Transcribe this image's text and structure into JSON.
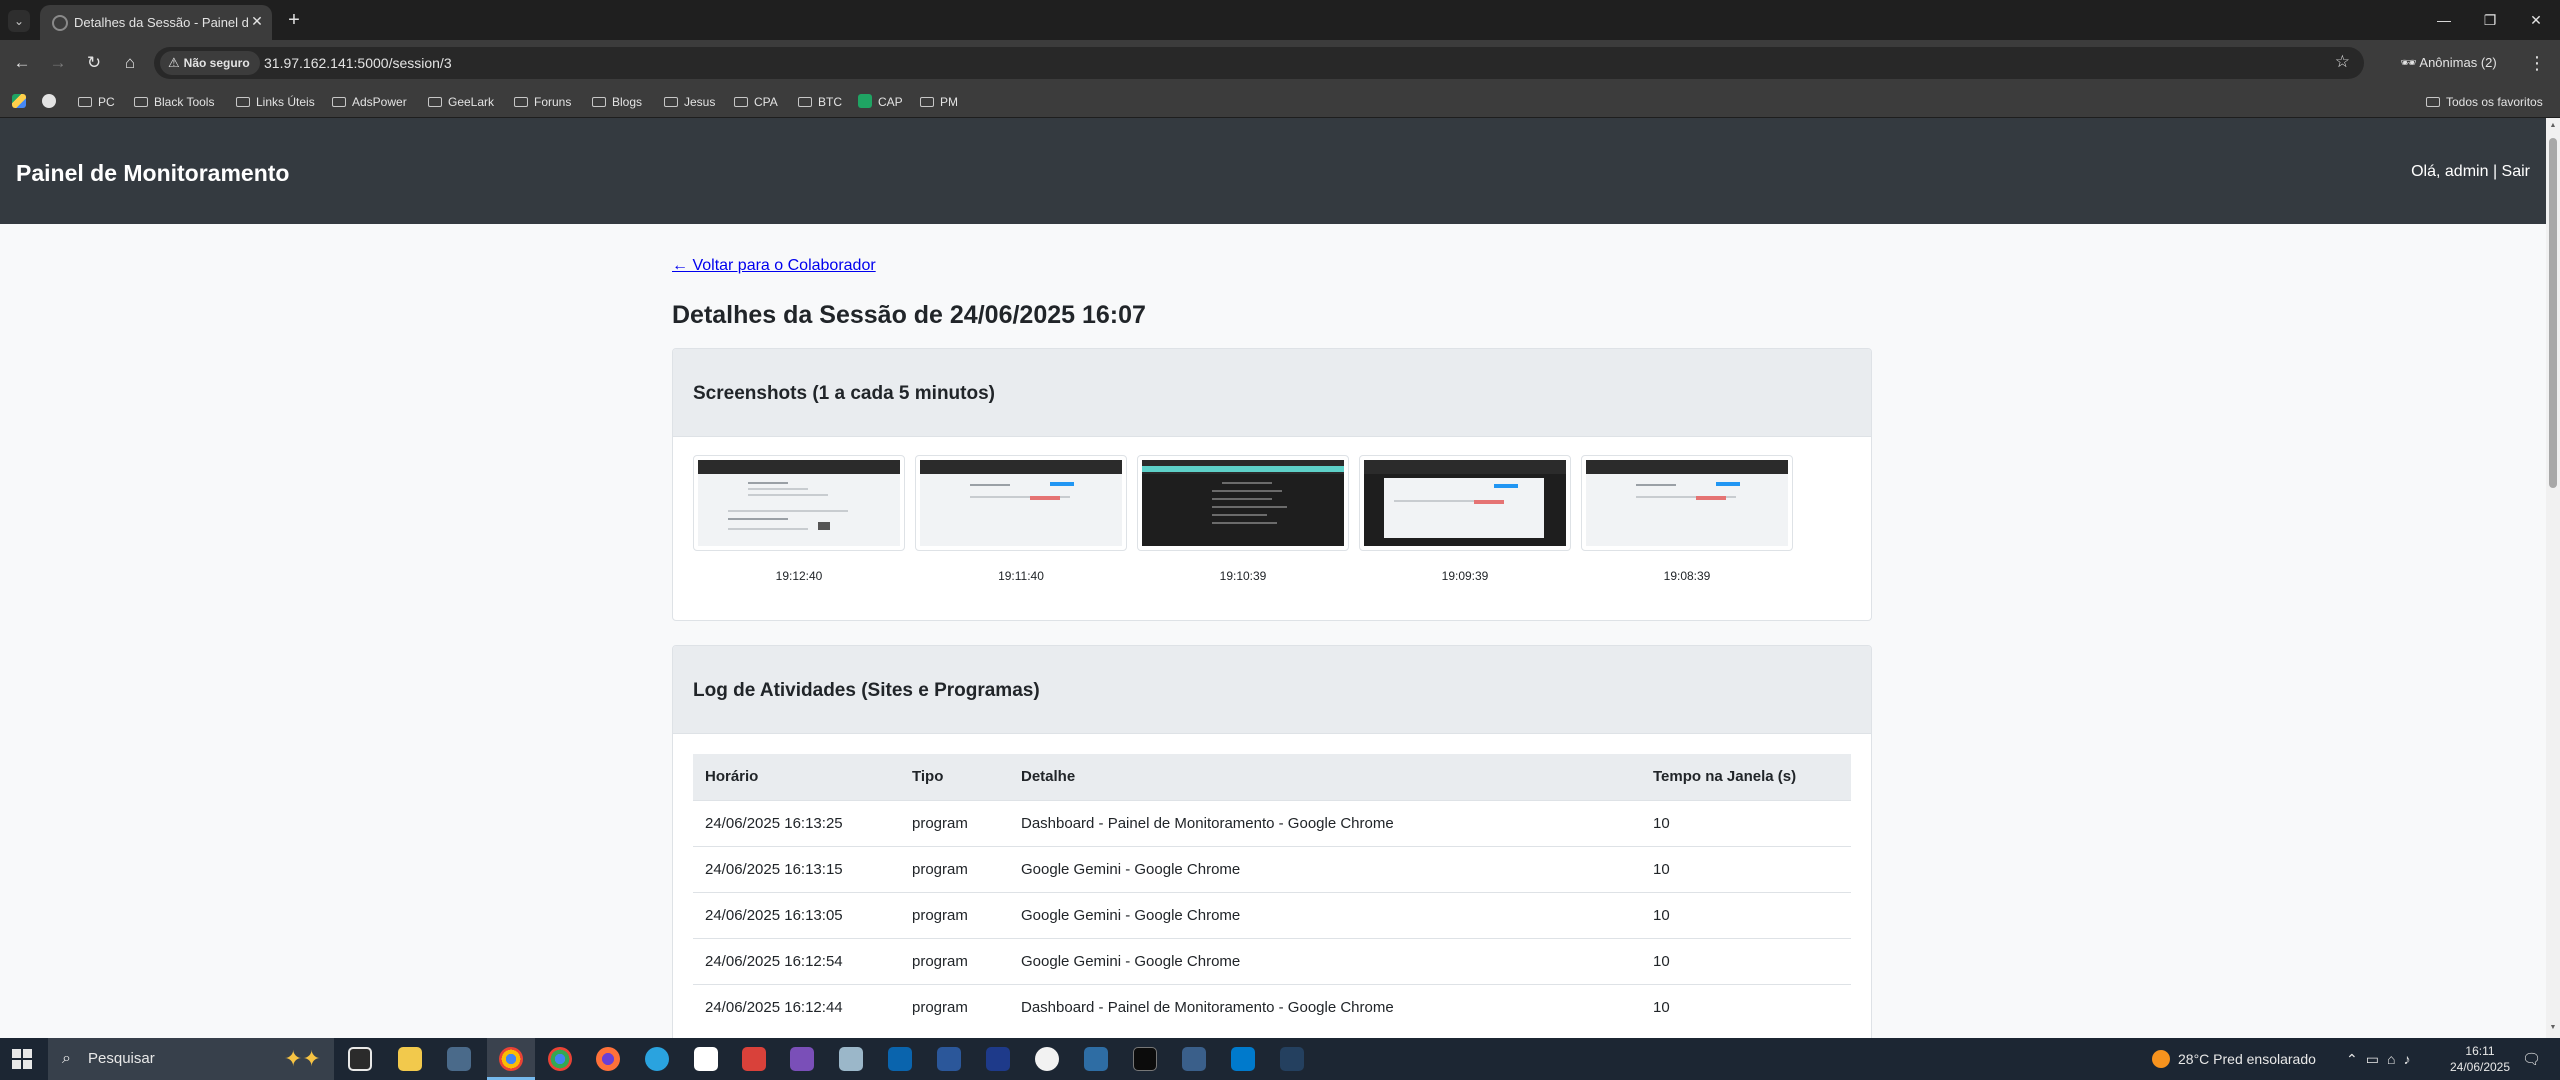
{
  "browser": {
    "tab_title": "Detalhes da Sessão - Painel de Monitoramento",
    "security_label": "Não seguro",
    "url": "31.97.162.141:5000/session/3",
    "incognito_label": "Anônimas (2)",
    "bookmarks": [
      "PC",
      "Black Tools",
      "Links Úteis",
      "AdsPower",
      "GeeLark",
      "Foruns",
      "Blogs",
      "Jesus",
      "CPA",
      "BTC",
      "CAP",
      "PM"
    ],
    "all_bookmarks_label": "Todos os favoritos"
  },
  "header": {
    "title": "Painel de Monitoramento",
    "greeting": "Olá, admin",
    "separator": "|",
    "logout_label": "Sair"
  },
  "main": {
    "back_link": "← Voltar para o Colaborador",
    "page_title": "Detalhes da Sessão de 24/06/2025 16:07",
    "screenshots_card": {
      "title": "Screenshots (1 a cada 5 minutos)",
      "items": [
        {
          "time": "19:12:40",
          "style": "light-form"
        },
        {
          "time": "19:11:40",
          "style": "light-blue"
        },
        {
          "time": "19:10:39",
          "style": "dark-editor"
        },
        {
          "time": "19:09:39",
          "style": "dark-dialog"
        },
        {
          "time": "19:08:39",
          "style": "light-blue"
        }
      ]
    },
    "log_card": {
      "title": "Log de Atividades (Sites e Programas)",
      "columns": [
        "Horário",
        "Tipo",
        "Detalhe",
        "Tempo na Janela (s)"
      ],
      "rows": [
        [
          "24/06/2025 16:13:25",
          "program",
          "Dashboard - Painel de Monitoramento - Google Chrome",
          "10"
        ],
        [
          "24/06/2025 16:13:15",
          "program",
          "Google Gemini - Google Chrome",
          "10"
        ],
        [
          "24/06/2025 16:13:05",
          "program",
          "Google Gemini - Google Chrome",
          "10"
        ],
        [
          "24/06/2025 16:12:54",
          "program",
          "Google Gemini - Google Chrome",
          "10"
        ],
        [
          "24/06/2025 16:12:44",
          "program",
          "Dashboard - Painel de Monitoramento - Google Chrome",
          "10"
        ]
      ]
    }
  },
  "taskbar": {
    "search_placeholder": "Pesquisar",
    "weather": "28°C  Pred ensolarado",
    "time": "16:11",
    "date": "24/06/2025",
    "apps": [
      "task-view",
      "file-explorer",
      "calculator",
      "chrome",
      "chrome-profile",
      "firefox",
      "telegram",
      "notion",
      "app-red",
      "app-purple",
      "app-pen",
      "app-outlook",
      "word",
      "app-blue",
      "app-circle",
      "app-teste",
      "terminal",
      "app-tools",
      "vscode",
      "app-pen2"
    ],
    "colors": {
      "accent": "#76b9ed",
      "header_bg": "#343a40",
      "link": "#0000ee"
    }
  }
}
